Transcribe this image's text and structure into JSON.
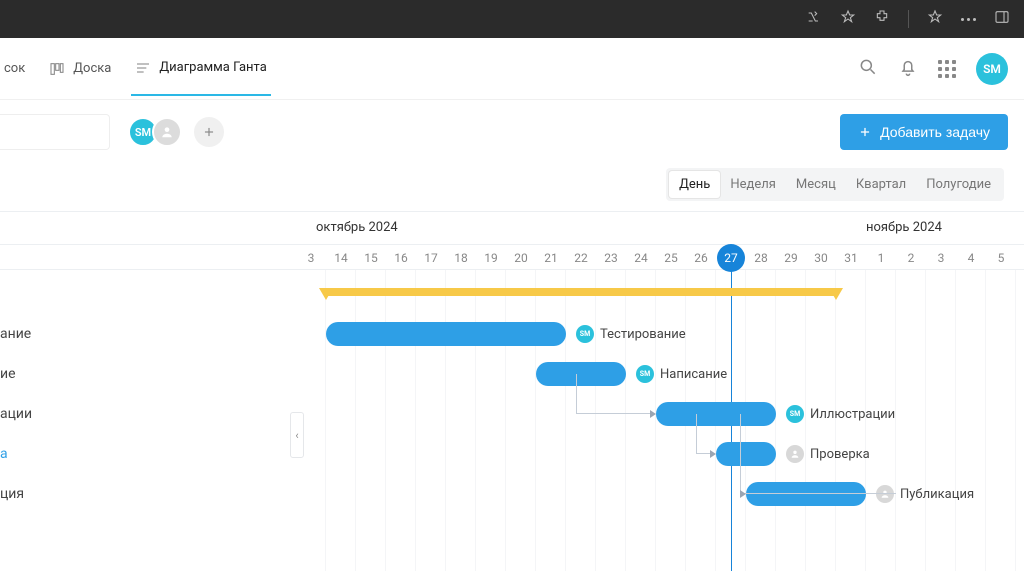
{
  "browser": {
    "icons": [
      "read-aloud",
      "star",
      "extensions",
      "favorites",
      "more",
      "sidebar"
    ]
  },
  "app": {
    "view_tabs": [
      {
        "id": "list",
        "label": "сок",
        "active": false
      },
      {
        "id": "board",
        "label": "Доска",
        "active": false
      },
      {
        "id": "gantt",
        "label": "Диаграмма Ганта",
        "active": true
      }
    ],
    "avatar_initials": "SM",
    "add_task_label": "Добавить задачу",
    "members": [
      "SM"
    ],
    "scales": [
      {
        "id": "day",
        "label": "День",
        "active": true
      },
      {
        "id": "week",
        "label": "Неделя",
        "active": false
      },
      {
        "id": "month",
        "label": "Месяц",
        "active": false
      },
      {
        "id": "quarter",
        "label": "Квартал",
        "active": false
      },
      {
        "id": "halfyear",
        "label": "Полугодие",
        "active": false
      }
    ]
  },
  "timeline": {
    "month_left": "октябрь 2024",
    "month_right": "ноябрь 2024",
    "today_index": 14,
    "days": [
      "3",
      "14",
      "15",
      "16",
      "17",
      "18",
      "19",
      "20",
      "21",
      "22",
      "23",
      "24",
      "25",
      "26",
      "27",
      "28",
      "29",
      "30",
      "31",
      "1",
      "2",
      "3",
      "4",
      "5"
    ]
  },
  "sidebar_fragments": [
    "",
    "ание",
    "ие",
    "ации",
    "а",
    "ция"
  ],
  "tasks": [
    {
      "name": "Тестирование",
      "start": 1,
      "end": 9,
      "row": 1,
      "assignee": "SM",
      "assignee_color": "teal"
    },
    {
      "name": "Написание",
      "start": 8,
      "end": 11,
      "row": 2,
      "assignee": "SM",
      "assignee_color": "teal"
    },
    {
      "name": "Иллюстрации",
      "start": 12,
      "end": 16,
      "row": 3,
      "assignee": "SM",
      "assignee_color": "teal"
    },
    {
      "name": "Проверка",
      "start": 14,
      "end": 16,
      "row": 4,
      "assignee": "",
      "assignee_color": "gray"
    },
    {
      "name": "Публикация",
      "start": 15,
      "end": 19,
      "row": 5,
      "assignee": "",
      "assignee_color": "gray"
    }
  ],
  "summary": {
    "start": 1,
    "end": 18
  },
  "colors": {
    "accent": "#2e9fe6",
    "teal": "#2bc1dc",
    "gold": "#f7c948"
  }
}
